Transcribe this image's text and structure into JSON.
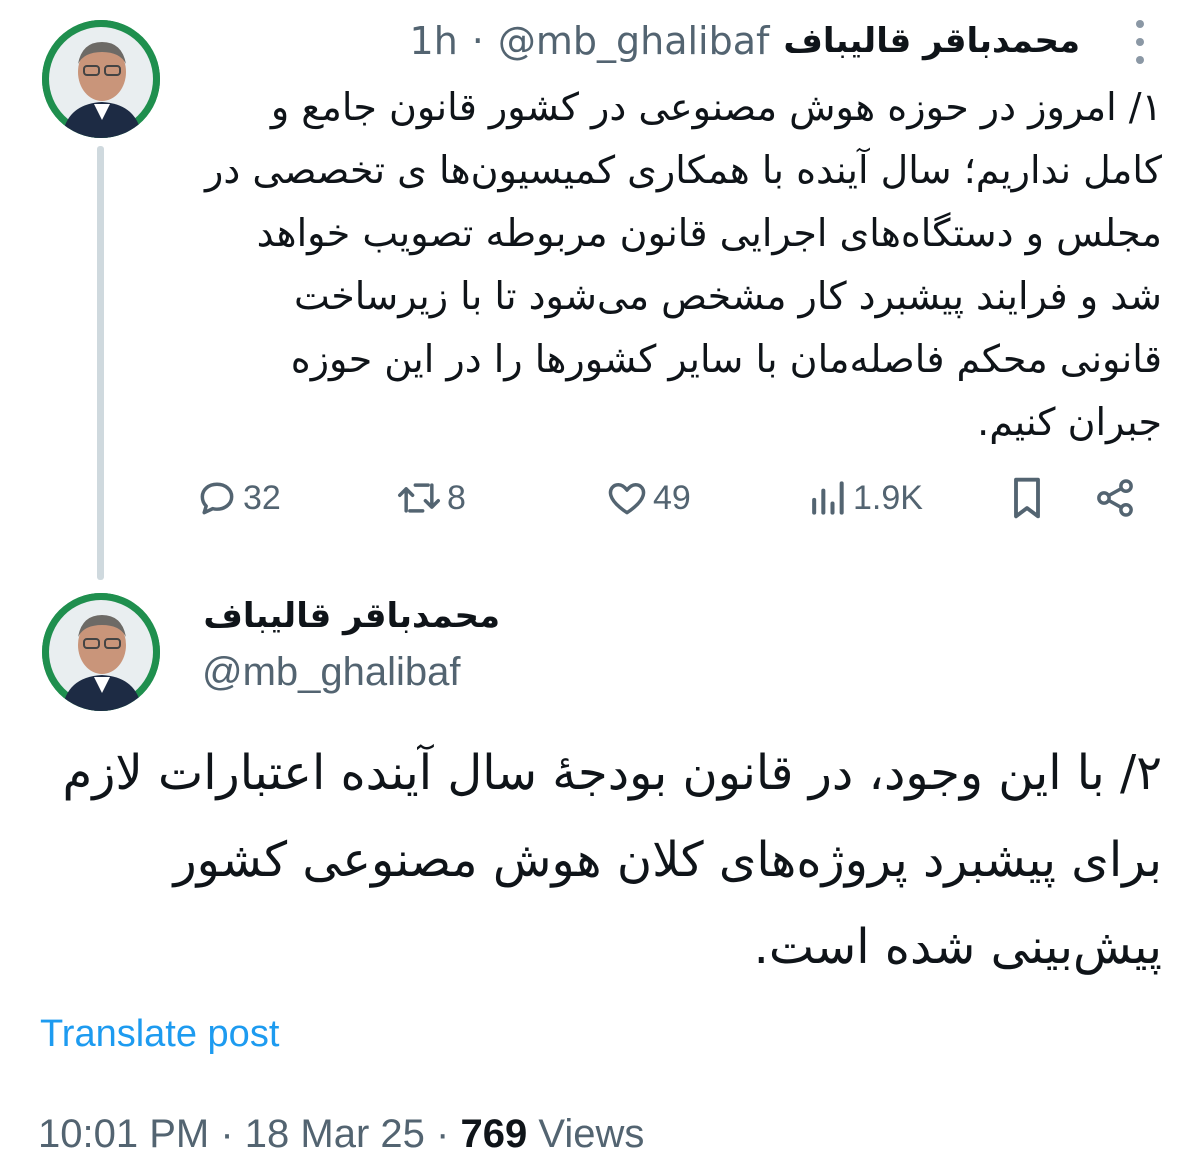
{
  "tweet1": {
    "display_name": "محمدباقر قالیباف",
    "handle": "@mb_ghalibaf",
    "separator": "·",
    "time": "1h",
    "text": "۱/ امروز در حوزه هوش مصنوعی در کشور قانون جامع و کامل نداریم؛ سال آینده با همکاری کمیسیون‌ها ی تخصصی در مجلس و دستگاه‌های اجرایی قانون مربوطه تصویب خواهد شد و فرایند پیشبرد کار مشخص می‌شود تا با زیرساخت قانونی محکم فاصله‌مان با سایر کشورها را در این حوزه جبران کنیم.",
    "actions": {
      "replies": "32",
      "reposts": "8",
      "likes": "49",
      "views": "1.9K"
    }
  },
  "tweet2": {
    "display_name": "محمدباقر قالیباف",
    "handle": "@mb_ghalibaf",
    "text": "۲/ با این وجود، در قانون بودجهٔ سال آینده اعتبارات لازم برای پیشبرد پروژه‌های کلان هوش مصنوعی کشور پیش‌بینی شده است.",
    "translate_label": "Translate post",
    "timestamp_time": "10:01 PM",
    "timestamp_date": "18 Mar 25",
    "separator": "·",
    "views_count": "769",
    "views_label": "Views"
  },
  "colors": {
    "text_primary": "#0f1419",
    "text_secondary": "#536471",
    "link": "#1d9bf0",
    "thread_line": "#cfd9de",
    "avatar_bg": "#1f8f4e"
  },
  "icons": [
    "reply-icon",
    "repost-icon",
    "like-icon",
    "views-icon",
    "bookmark-icon",
    "share-icon",
    "more-icon"
  ]
}
